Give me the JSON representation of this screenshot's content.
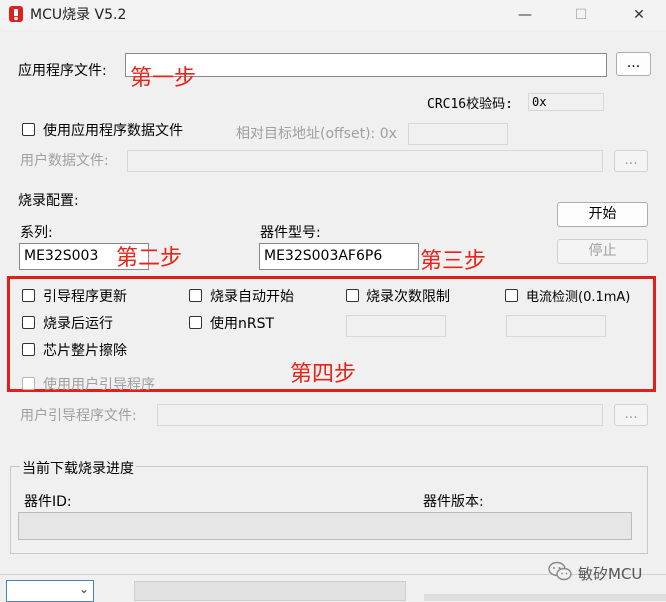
{
  "window": {
    "title": "MCU烧录 V5.2",
    "minimize": "—",
    "maximize": "☐",
    "close": "✕"
  },
  "app_file": {
    "label": "应用程序文件:",
    "value": "",
    "browse": "...",
    "annotation": "第一步"
  },
  "crc": {
    "label": "CRC16校验码:",
    "value": "0x"
  },
  "app_data": {
    "checkbox_label": "使用应用程序数据文件",
    "offset_label": "相对目标地址(offset): 0x",
    "offset_value": ""
  },
  "user_data": {
    "label": "用户数据文件:",
    "value": "",
    "browse": "..."
  },
  "config": {
    "title": "烧录配置:",
    "series_label": "系列:",
    "series_value": "ME32S003",
    "device_label": "器件型号:",
    "device_value": "ME32S003AF6P6",
    "annotation_series": "第二步",
    "annotation_device": "第三步"
  },
  "actions": {
    "start": "开始",
    "stop": "停止"
  },
  "options": {
    "boot_update": "引导程序更新",
    "auto_start": "烧录自动开始",
    "count_limit": "烧录次数限制",
    "current_detect": "电流检测(0.1mA)",
    "run_after": "烧录后运行",
    "use_nrst": "使用nRST",
    "chip_erase": "芯片整片擦除",
    "use_user_boot": "使用用户引导程序",
    "annotation": "第四步"
  },
  "user_boot": {
    "label": "用户引导程序文件:",
    "value": "",
    "browse": "..."
  },
  "progress": {
    "title": "当前下载烧录进度",
    "device_id_label": "器件ID:",
    "device_version_label": "器件版本:",
    "fraction": 0
  },
  "watermark": {
    "text": "敏矽MCU"
  },
  "colors": {
    "annotation_red": "#e8231a"
  }
}
